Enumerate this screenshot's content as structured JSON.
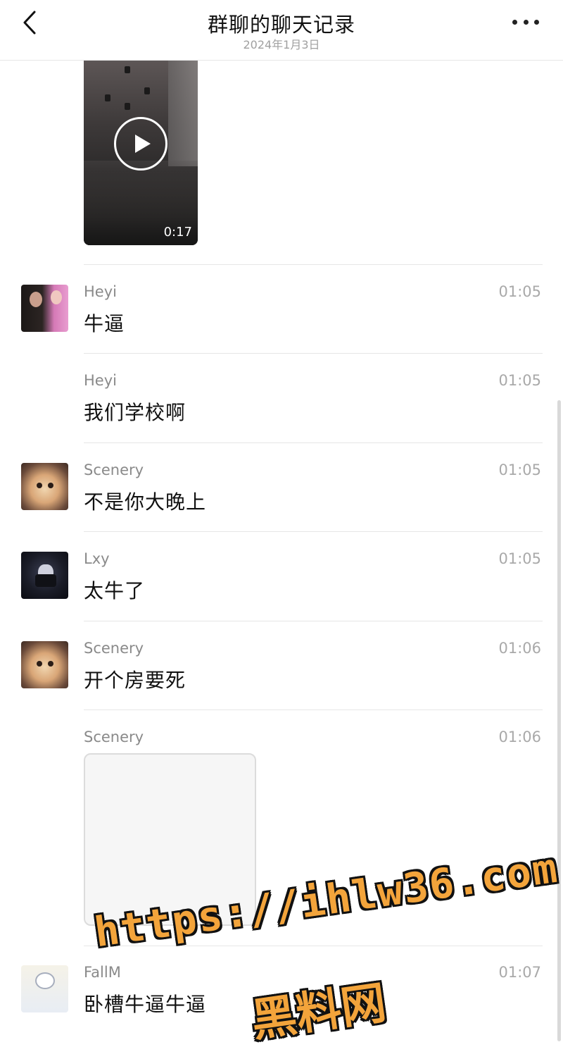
{
  "header": {
    "title": "群聊的聊天记录",
    "date": "2024年1月3日"
  },
  "video": {
    "duration": "0:17"
  },
  "messages": [
    {
      "sender": "Heyi",
      "time": "01:05",
      "text": "牛逼",
      "avatar": "heyi"
    },
    {
      "sender": "Heyi",
      "time": "01:05",
      "text": "我们学校啊",
      "avatar": ""
    },
    {
      "sender": "Scenery",
      "time": "01:05",
      "text": "不是你大晚上",
      "avatar": "cat"
    },
    {
      "sender": "Lxy",
      "time": "01:05",
      "text": "太牛了",
      "avatar": "lxy"
    },
    {
      "sender": "Scenery",
      "time": "01:06",
      "text": "开个房要死",
      "avatar": "cat"
    },
    {
      "sender": "Scenery",
      "time": "01:06",
      "text": "",
      "avatar": ""
    },
    {
      "sender": "FallM",
      "time": "01:07",
      "text": "卧槽牛逼牛逼",
      "avatar": "fal"
    }
  ],
  "watermark": {
    "line1": "https://ihlw36.com",
    "line2": "黑料网"
  },
  "icons": {
    "back": "chevron-left-icon",
    "more": "more-dots-icon",
    "play": "play-icon"
  }
}
